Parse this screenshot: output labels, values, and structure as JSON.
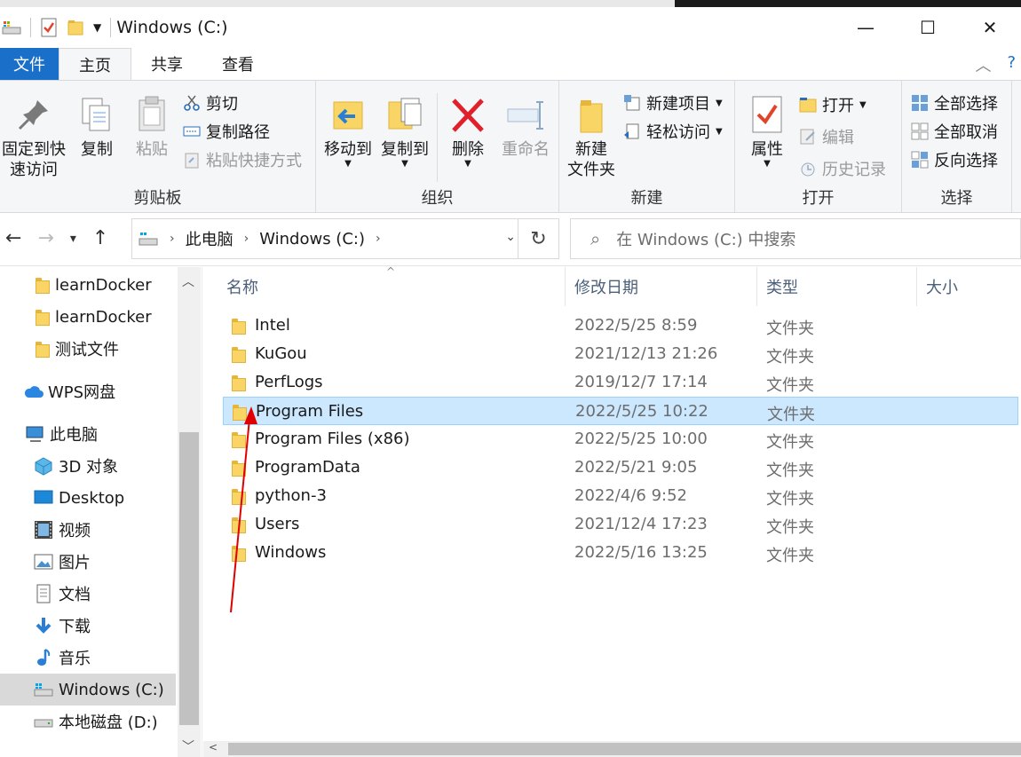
{
  "window": {
    "title": "Windows (C:)",
    "minimize_glyph": "—",
    "maximize_glyph": "☐",
    "close_glyph": "✕"
  },
  "tabs": [
    "文件",
    "主页",
    "共享",
    "查看"
  ],
  "ribbon": {
    "clipboard": {
      "label": "剪贴板",
      "pin": "固定到快速访问",
      "pin_line1": "固定到快",
      "pin_line2": "速访问",
      "copy": "复制",
      "paste": "粘贴",
      "cut": "剪切",
      "copy_path": "复制路径",
      "paste_shortcut": "粘贴快捷方式"
    },
    "organize": {
      "label": "组织",
      "move_to": "移动到",
      "copy_to": "复制到",
      "delete": "删除",
      "rename": "重命名"
    },
    "new": {
      "label": "新建",
      "new_folder_line1": "新建",
      "new_folder_line2": "文件夹",
      "new_item": "新建项目",
      "easy_access": "轻松访问"
    },
    "open": {
      "label": "打开",
      "properties": "属性",
      "open": "打开",
      "edit": "编辑",
      "history": "历史记录"
    },
    "select": {
      "label": "选择",
      "select_all": "全部选择",
      "select_none": "全部取消",
      "invert": "反向选择"
    }
  },
  "address": {
    "crumbs": [
      "此电脑",
      "Windows (C:)"
    ],
    "search_placeholder": "在 Windows (C:) 中搜索"
  },
  "nav_pane": {
    "items": [
      {
        "label": "learnDocker",
        "icon": "folder-icon"
      },
      {
        "label": "learnDocker",
        "icon": "folder-icon"
      },
      {
        "label": "测试文件",
        "icon": "folder-icon"
      },
      {
        "label": "WPS网盘",
        "icon": "cloud-icon"
      },
      {
        "label": "此电脑",
        "icon": "computer-icon"
      },
      {
        "label": "3D 对象",
        "icon": "3d-objects-icon"
      },
      {
        "label": "Desktop",
        "icon": "desktop-icon"
      },
      {
        "label": "视频",
        "icon": "video-icon"
      },
      {
        "label": "图片",
        "icon": "pictures-icon"
      },
      {
        "label": "文档",
        "icon": "documents-icon"
      },
      {
        "label": "下载",
        "icon": "download-icon"
      },
      {
        "label": "音乐",
        "icon": "music-icon"
      },
      {
        "label": "Windows (C:)",
        "icon": "drive-icon"
      },
      {
        "label": "本地磁盘 (D:)",
        "icon": "drive-icon"
      }
    ]
  },
  "columns": [
    "名称",
    "修改日期",
    "类型",
    "大小"
  ],
  "files": [
    {
      "name": "Intel",
      "date": "2022/5/25 8:59",
      "type": "文件夹"
    },
    {
      "name": "KuGou",
      "date": "2021/12/13 21:26",
      "type": "文件夹"
    },
    {
      "name": "PerfLogs",
      "date": "2019/12/7 17:14",
      "type": "文件夹"
    },
    {
      "name": "Program Files",
      "date": "2022/5/25 10:22",
      "type": "文件夹",
      "selected": true
    },
    {
      "name": "Program Files (x86)",
      "date": "2022/5/25 10:00",
      "type": "文件夹"
    },
    {
      "name": "ProgramData",
      "date": "2022/5/21 9:05",
      "type": "文件夹"
    },
    {
      "name": "python-3",
      "date": "2022/4/6 9:52",
      "type": "文件夹"
    },
    {
      "name": "Users",
      "date": "2021/12/4 17:23",
      "type": "文件夹"
    },
    {
      "name": "Windows",
      "date": "2022/5/16 13:25",
      "type": "文件夹"
    }
  ],
  "colors": {
    "accent": "#1a6fc9",
    "selection": "#cce8ff",
    "selection_border": "#99d1ff",
    "annotation_arrow": "#e00000"
  }
}
